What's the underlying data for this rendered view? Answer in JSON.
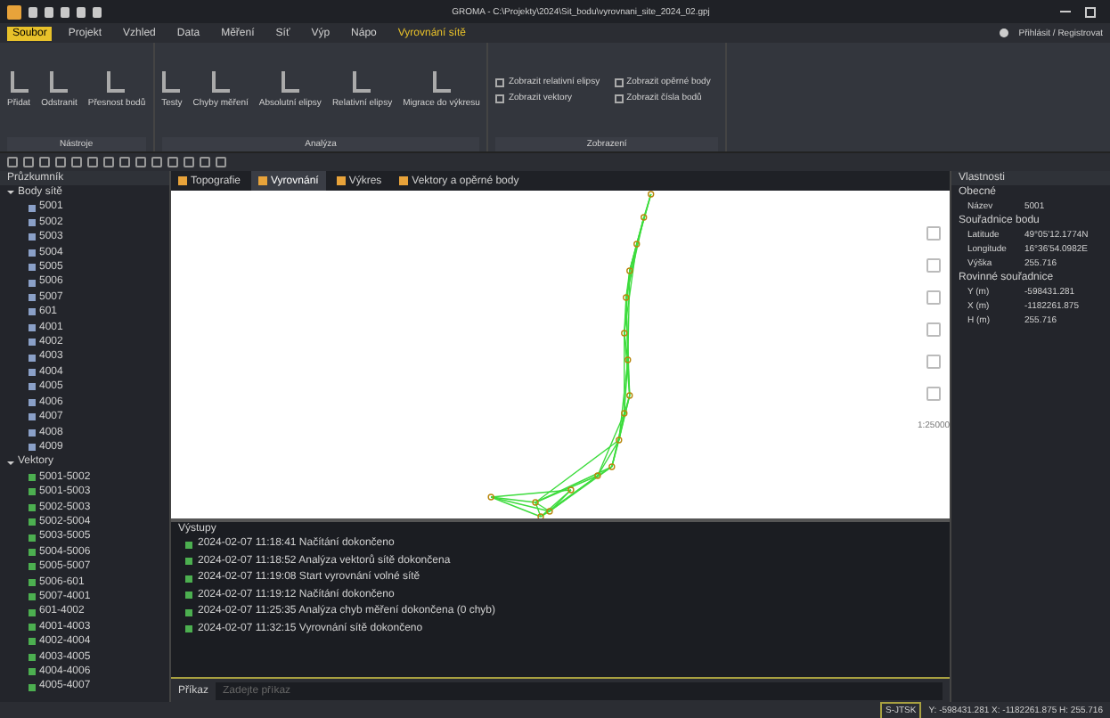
{
  "window": {
    "title": "GROMA - C:\\Projekty\\2024\\Sit_bodu\\vyrovnani_site_2024_02.gpj"
  },
  "menu": [
    {
      "label": "Soubor",
      "selected": true
    },
    {
      "label": "Projekt",
      "selected": false
    },
    {
      "label": "Vzhled",
      "selected": false
    },
    {
      "label": "Data",
      "selected": false
    },
    {
      "label": "Měření",
      "selected": false
    },
    {
      "label": "Síť",
      "selected": false
    },
    {
      "label": "Výp",
      "selected": false
    },
    {
      "label": "Nápo",
      "selected": false
    },
    {
      "label": "Vyrovnání sítě",
      "selected": false
    }
  ],
  "account": "Přihlásit / Registrovat",
  "ribbon": {
    "groups": [
      {
        "label": "Nástroje",
        "buttons": [
          "Přidat",
          "Odstranit",
          "Přesnost bodů"
        ]
      },
      {
        "label": "Analýza",
        "buttons": [
          "Testy",
          "Chyby měření",
          "Absolutní elipsy",
          "Relativní elipsy",
          "Migrace do výkresu"
        ]
      },
      {
        "label": "Zobrazení",
        "checks": [
          {
            "label": "Zobrazit relativní elipsy",
            "checked": false
          },
          {
            "label": "Zobrazit opěrné body",
            "checked": false
          },
          {
            "label": "Zobrazit vektory",
            "checked": false
          },
          {
            "label": "Zobrazit čísla bodů",
            "checked": false
          }
        ]
      }
    ]
  },
  "explorer": {
    "title": "Průzkumník",
    "groups": [
      {
        "label": "Body sítě",
        "expanded": true,
        "children": [
          "5001",
          "5002",
          "5003",
          "5004",
          "5005",
          "5006",
          "5007",
          "601",
          "4001",
          "4002",
          "4003",
          "4004",
          "4005",
          "4006",
          "4007",
          "4008",
          "4009"
        ]
      },
      {
        "label": "Vektory",
        "expanded": true,
        "children": [
          "5001-5002",
          "5001-5003",
          "5002-5003",
          "5002-5004",
          "5003-5005",
          "5004-5006",
          "5005-5007",
          "5006-601",
          "5007-4001",
          "601-4002",
          "4001-4003",
          "4002-4004",
          "4003-4005",
          "4004-4006",
          "4005-4007"
        ]
      }
    ]
  },
  "doc_tabs": [
    {
      "label": "Topografie",
      "selected": false
    },
    {
      "label": "Vyrovnání",
      "selected": true
    },
    {
      "label": "Výkres",
      "selected": false
    },
    {
      "label": "Vektory a opěrné body",
      "selected": false
    }
  ],
  "canvas_scale": "1:25000",
  "log": {
    "title": "Výstupy",
    "entries": [
      "2024-02-07 11:18:41 Načítání dokončeno",
      "2024-02-07 11:18:52 Analýza vektorů sítě dokončena",
      "2024-02-07 11:19:08 Start vyrovnání volné sítě",
      "2024-02-07 11:19:12 Načítání dokončeno",
      "2024-02-07 11:25:35 Analýza chyb měření dokončena (0 chyb)",
      "2024-02-07 11:32:15 Vyrovnání sítě dokončeno"
    ]
  },
  "command": {
    "label": "Příkaz",
    "placeholder": "Zadejte příkaz"
  },
  "properties": {
    "title": "Vlastnosti",
    "sections": [
      {
        "label": "Obecné",
        "rows": [
          [
            "Název",
            "5001"
          ]
        ]
      },
      {
        "label": "Souřadnice bodu",
        "rows": [
          [
            "Latitude",
            "49°05'12.1774N"
          ],
          [
            "Longitude",
            "16°36'54.0982E"
          ],
          [
            "Výška",
            "255.716"
          ]
        ]
      },
      {
        "label": "Rovinné souřadnice",
        "rows": [
          [
            "Y (m)",
            "-598431.281"
          ],
          [
            "X (m)",
            "-1182261.875"
          ],
          [
            "H (m)",
            "255.716"
          ]
        ]
      }
    ]
  },
  "status": {
    "mode": "S-JTSK",
    "coords": "Y: -598431.281  X: -1182261.875  H: 255.716"
  }
}
